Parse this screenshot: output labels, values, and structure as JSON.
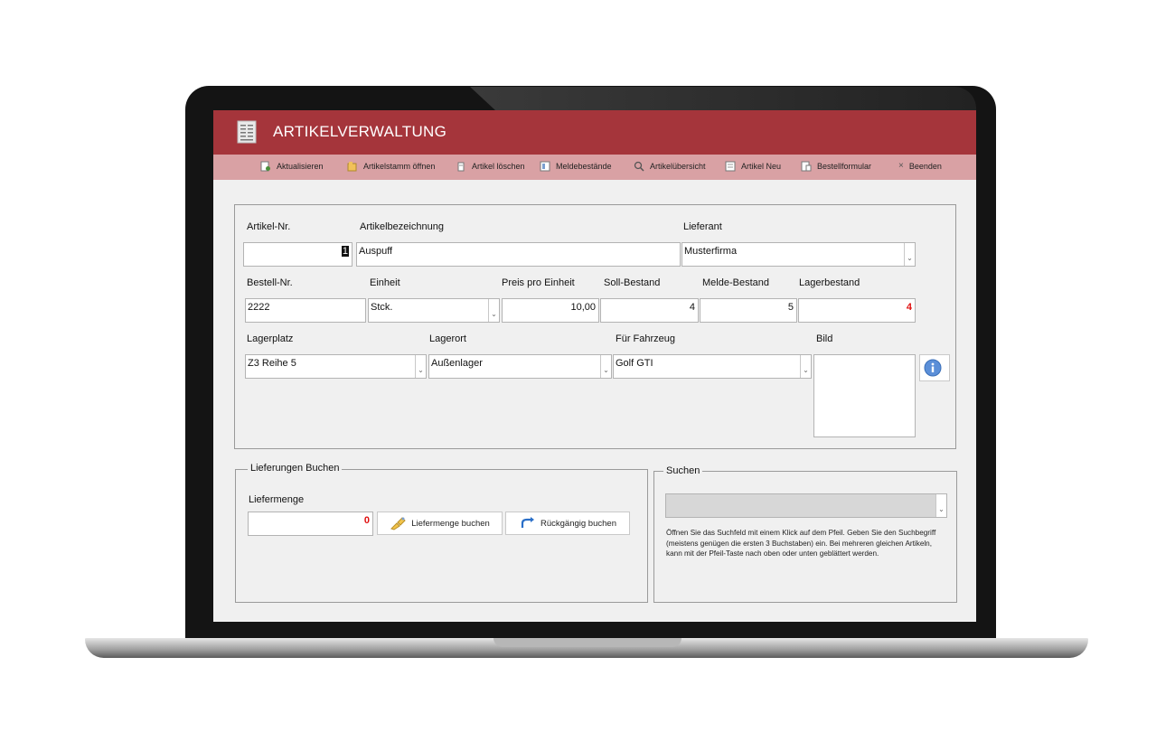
{
  "app": {
    "title": "ARTIKELVERWALTUNG"
  },
  "toolbar": {
    "items": [
      {
        "label": "Aktualisieren"
      },
      {
        "label": "Artikelstamm öffnen"
      },
      {
        "label": "Artikel löschen"
      },
      {
        "label": "Meldebestände"
      },
      {
        "label": "Artikelübersicht"
      },
      {
        "label": "Artikel Neu"
      },
      {
        "label": "Bestellformular"
      },
      {
        "label": "Beenden"
      }
    ]
  },
  "form": {
    "artikel_nr": {
      "label": "Artikel-Nr.",
      "value": "1"
    },
    "artikelbezeichnung": {
      "label": "Artikelbezeichnung",
      "value": "Auspuff"
    },
    "lieferant": {
      "label": "Lieferant",
      "value": "Musterfirma"
    },
    "bestell_nr": {
      "label": "Bestell-Nr.",
      "value": "2222"
    },
    "einheit": {
      "label": "Einheit",
      "value": "Stck."
    },
    "preis": {
      "label": "Preis pro Einheit",
      "value": "10,00"
    },
    "soll_bestand": {
      "label": "Soll-Bestand",
      "value": "4"
    },
    "melde_bestand": {
      "label": "Melde-Bestand",
      "value": "5"
    },
    "lagerbestand": {
      "label": "Lagerbestand",
      "value": "4"
    },
    "lagerplatz": {
      "label": "Lagerplatz",
      "value": "Z3 Reihe 5"
    },
    "lagerort": {
      "label": "Lagerort",
      "value": "Außenlager"
    },
    "fahrzeug": {
      "label": "Für Fahrzeug",
      "value": "Golf GTI"
    },
    "bild": {
      "label": "Bild"
    }
  },
  "lieferungen": {
    "legend": "Lieferungen Buchen",
    "liefermenge_label": "Liefermenge",
    "liefermenge_value": "0",
    "book_button": "Liefermenge buchen",
    "undo_button": "Rückgängig buchen"
  },
  "suchen": {
    "legend": "Suchen",
    "help": "Öffnen Sie das Suchfeld mit einem Klick auf dem Pfeil. Geben Sie den Suchbegriff (meistens genügen die ersten 3 Buchstaben) ein. Bei mehreren gleichen Artikeln, kann mit der Pfeil-Taste nach oben oder unten geblättert werden."
  },
  "colors": {
    "header": "#a5353b",
    "toolbar": "#d9a1a4",
    "accent_red": "#e01010"
  },
  "icons": [
    "document-icon",
    "refresh-icon",
    "folder-icon",
    "delete-icon",
    "report-icon",
    "search-icon",
    "new-icon",
    "form-icon",
    "close-icon",
    "info-icon",
    "book-icon",
    "undo-icon",
    "chevron-down-icon"
  ]
}
